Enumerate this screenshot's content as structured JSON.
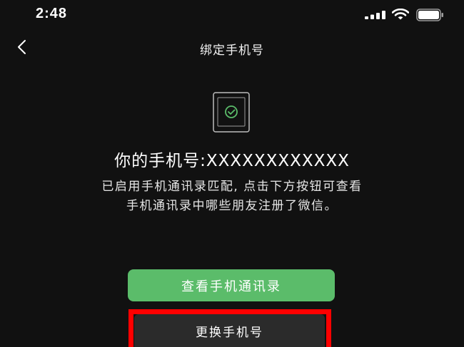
{
  "status_bar": {
    "time": "2:48"
  },
  "nav": {
    "title": "绑定手机号"
  },
  "main": {
    "number_label": "你的手机号:",
    "number_value": "XXXXXXXXXXXX",
    "description_line1": "已启用手机通讯录匹配, 点击下方按钮可查看",
    "description_line2": "手机通讯录中哪些朋友注册了微信。"
  },
  "buttons": {
    "view_contacts": "查看手机通讯录",
    "change_number": "更换手机号"
  },
  "colors": {
    "background": "#111111",
    "primary_button": "#5bbc6a",
    "secondary_button": "#2b2b2b",
    "highlight": "#ff0000"
  },
  "icons": {
    "signal": "signal-icon",
    "wifi": "wifi-icon",
    "battery": "battery-icon",
    "back": "back-chevron-icon",
    "phone": "phone-check-icon"
  }
}
